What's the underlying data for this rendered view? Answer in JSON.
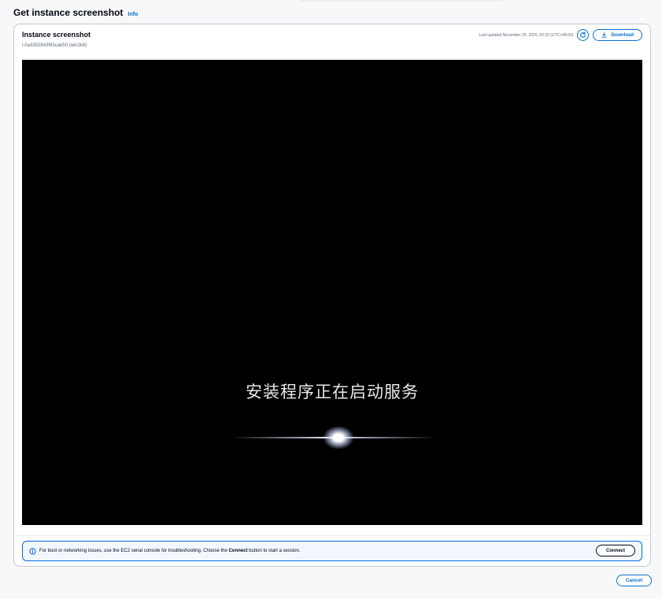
{
  "page": {
    "title": "Get instance screenshot",
    "info_label": "Info"
  },
  "panel": {
    "title": "Instance screenshot",
    "subtitle": "i-0a4352843f65cab50 (win2k8)",
    "last_updated": "Last updated November 25, 2025, 00:32 (UTC+08:00)",
    "refresh_icon": "refresh-icon",
    "download_label": "Download",
    "download_icon": "download-icon"
  },
  "screenshot": {
    "text": "安装程序正在启动服务"
  },
  "alert": {
    "icon": "info-circle-icon",
    "text_before": "For boot or networking issues, use the EC2 serial console for troubleshooting. Choose the ",
    "text_bold": "Connect",
    "text_after": " button to start a session.",
    "connect_label": "Connect"
  },
  "footer": {
    "cancel_label": "Cancel"
  },
  "colors": {
    "accent": "#0972d3",
    "alert_border": "#006ce0",
    "alert_background": "#f2f8fd",
    "text": "#000716",
    "secondary_text": "#5f6b7a"
  }
}
